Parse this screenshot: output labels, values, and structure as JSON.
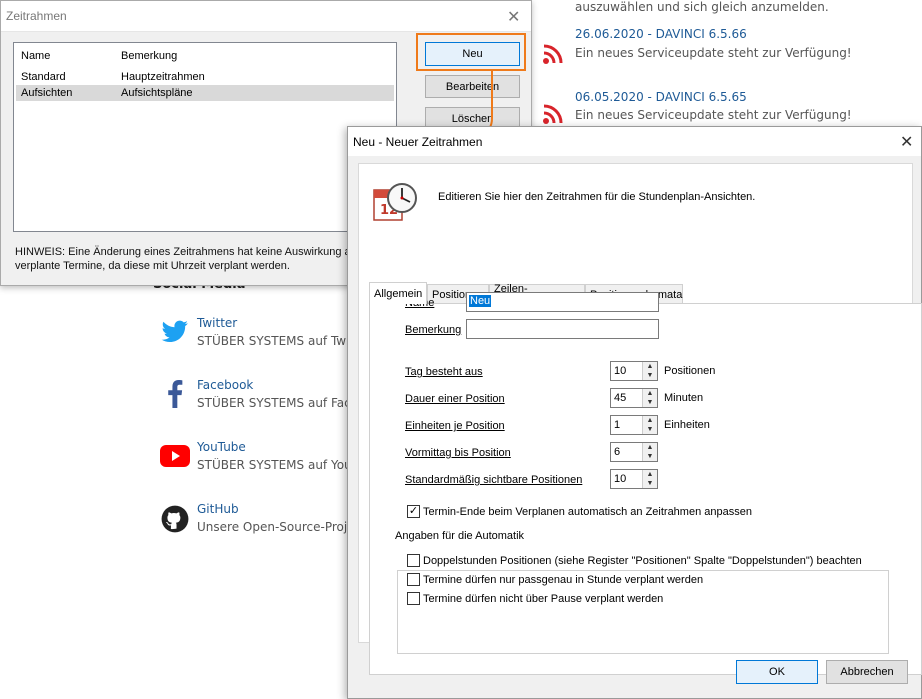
{
  "background": {
    "news": [
      {
        "title": "",
        "text": "auszuwählen und sich gleich anzumelden."
      },
      {
        "title": "26.06.2020 - DAVINCI 6.5.66",
        "text": "Ein neues Serviceupdate steht zur Verfügung!"
      },
      {
        "title": "06.05.2020 - DAVINCI 6.5.65",
        "text": "Ein neues Serviceupdate steht zur Verfügung!"
      }
    ],
    "social_heading": "Social Media",
    "social": [
      {
        "name": "Twitter",
        "sub": "STÜBER SYSTEMS auf Twitter",
        "icon": "twitter-icon",
        "color": "#1da1f2"
      },
      {
        "name": "Facebook",
        "sub": "STÜBER SYSTEMS auf Facebook",
        "icon": "facebook-icon",
        "color": "#3b5998"
      },
      {
        "name": "YouTube",
        "sub": "STÜBER SYSTEMS auf YouTube",
        "icon": "youtube-icon",
        "color": "#ff0000"
      },
      {
        "name": "GitHub",
        "sub": "Unsere Open-Source-Projekte",
        "icon": "github-icon",
        "color": "#222222"
      }
    ],
    "rss_color": "#d8242b"
  },
  "zeitrahmen_dialog": {
    "title": "Zeitrahmen",
    "columns": [
      "Name",
      "Bemerkung"
    ],
    "rows": [
      {
        "name": "Standard",
        "remark": "Hauptzeitrahmen",
        "selected": false
      },
      {
        "name": "Aufsichten",
        "remark": "Aufsichtspläne",
        "selected": true
      }
    ],
    "buttons": {
      "new": "Neu",
      "edit": "Bearbeiten",
      "delete": "Löschen"
    },
    "hint_line1": "HINWEIS: Eine Änderung eines Zeitrahmens hat keine Auswirkung auf",
    "hint_line2": "verplante Termine, da diese mit Uhrzeit verplant werden.",
    "highlight_color": "#ef7a1a"
  },
  "new_dialog": {
    "title": "Neu - Neuer Zeitrahmen",
    "intro": "Editieren Sie hier den Zeitrahmen für die Stundenplan-Ansichten.",
    "tabs": [
      "Allgemein",
      "Positionen",
      "Zeilen-Trennlinien",
      "Positionsschemata"
    ],
    "active_tab": "Allgemein",
    "fields": {
      "name_label": "Name",
      "name_value": "Neu",
      "remark_label": "Bemerkung",
      "remark_value": ""
    },
    "spinners": [
      {
        "label": "Tag besteht aus",
        "value": "10",
        "unit": "Positionen"
      },
      {
        "label": "Dauer einer Position",
        "value": "45",
        "unit": "Minuten"
      },
      {
        "label": "Einheiten je Position",
        "value": "1",
        "unit": "Einheiten"
      },
      {
        "label": "Vormittag bis Position",
        "value": "6",
        "unit": ""
      },
      {
        "label": "Standardmäßig sichtbare Positionen",
        "value": "10",
        "unit": ""
      }
    ],
    "auto_adjust": {
      "label": "Termin-Ende beim Verplanen automatisch an Zeitrahmen anpassen",
      "checked": true
    },
    "group_title": "Angaben für die Automatik",
    "group_checks": [
      {
        "label": "Doppelstunden Positionen (siehe Register \"Positionen\" Spalte \"Doppelstunden\") beachten",
        "checked": false
      },
      {
        "label": "Termine dürfen nur passgenau in Stunde verplant werden",
        "checked": false
      },
      {
        "label": "Termine dürfen nicht über Pause verplant werden",
        "checked": false
      }
    ],
    "ok": "OK",
    "cancel": "Abbrechen"
  }
}
